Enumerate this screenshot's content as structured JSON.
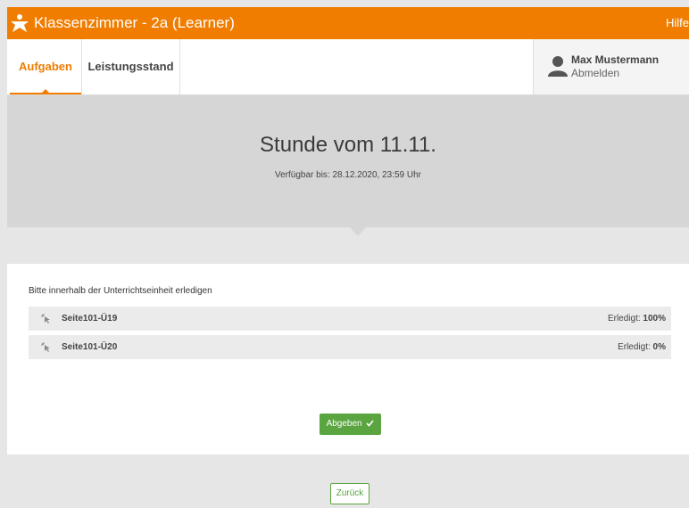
{
  "header": {
    "app_title": "Klassenzimmer - 2a (Learner)",
    "help_label": "Hilfe",
    "logo_icon": "logo-icon",
    "brand_color": "#f07d00"
  },
  "nav": {
    "tabs": [
      {
        "label": "Aufgaben",
        "active": true
      },
      {
        "label": "Leistungsstand",
        "active": false
      }
    ],
    "user": {
      "name": "Max Mustermann",
      "logout_label": "Abmelden",
      "avatar_icon": "user-avatar-icon"
    }
  },
  "lesson": {
    "title": "Stunde vom 11.11.",
    "available_until": "Verfügbar bis: 28.12.2020, 23:59 Uhr"
  },
  "tasks": {
    "instruction": "Bitte innerhalb der Unterrichtseinheit erledigen",
    "status_label": "Erledigt:",
    "items": [
      {
        "name": "Seite101-Ü19",
        "done": "100%",
        "icon": "cursor-icon"
      },
      {
        "name": "Seite101-Ü20",
        "done": "0%",
        "icon": "cursor-icon"
      }
    ]
  },
  "actions": {
    "submit_label": "Abgeben",
    "submit_icon": "checkmark-icon",
    "submit_color": "#5aa540",
    "back_label": "Zurück"
  }
}
